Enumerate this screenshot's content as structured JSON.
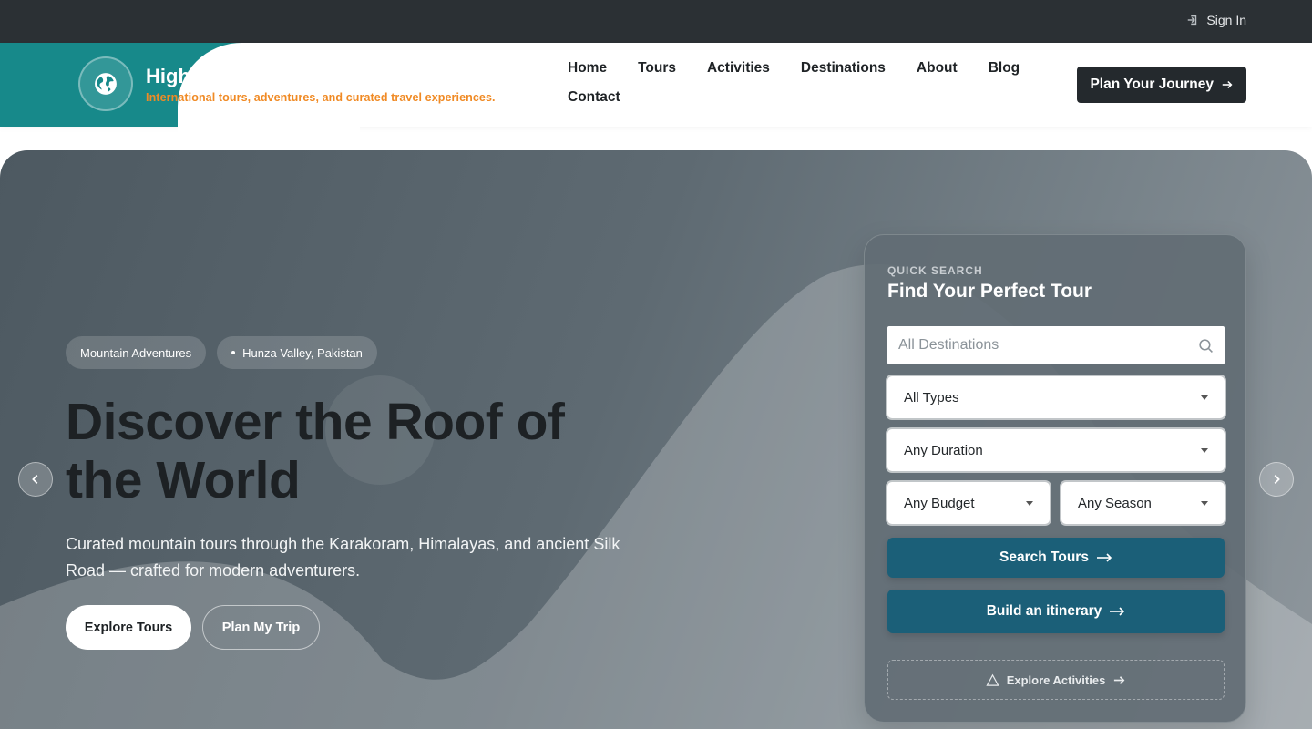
{
  "topbar": {
    "signin_label": "Sign In",
    "signin_icon": "sign-in-icon"
  },
  "brand": {
    "name": "HighPa",
    "tagline": "International tours, adventures, and curated travel experiences.",
    "logo_icon": "globe-icon",
    "color": "#17898a",
    "tagline_color": "#f08a24"
  },
  "nav": {
    "items": [
      "Home",
      "Tours",
      "Activities",
      "Destinations",
      "About",
      "Blog",
      "Contact"
    ]
  },
  "header_cta": {
    "label": "Plan Your Journey"
  },
  "hero": {
    "pills": [
      "Mountain Adventures",
      "Hunza Valley, Pakistan"
    ],
    "title": "Discover the Roof of the World",
    "subtitle": "Curated mountain tours through the Karakoram, Himalayas, and ancient Silk Road — crafted for modern adventurers.",
    "primary_cta": "Explore Tours",
    "secondary_cta": "Plan My Trip"
  },
  "search_card": {
    "eyebrow": "QUICK SEARCH",
    "title": "Find Your Perfect Tour",
    "destination_placeholder": "All Destinations",
    "type_value": "All Types",
    "duration_value": "Any Duration",
    "budget_value": "Any Budget",
    "season_value": "Any Season",
    "search_label": "Search Tours",
    "itinerary_label": "Build an itinerary",
    "explore_label": "Explore Activities",
    "button_color": "#1b5f78"
  }
}
